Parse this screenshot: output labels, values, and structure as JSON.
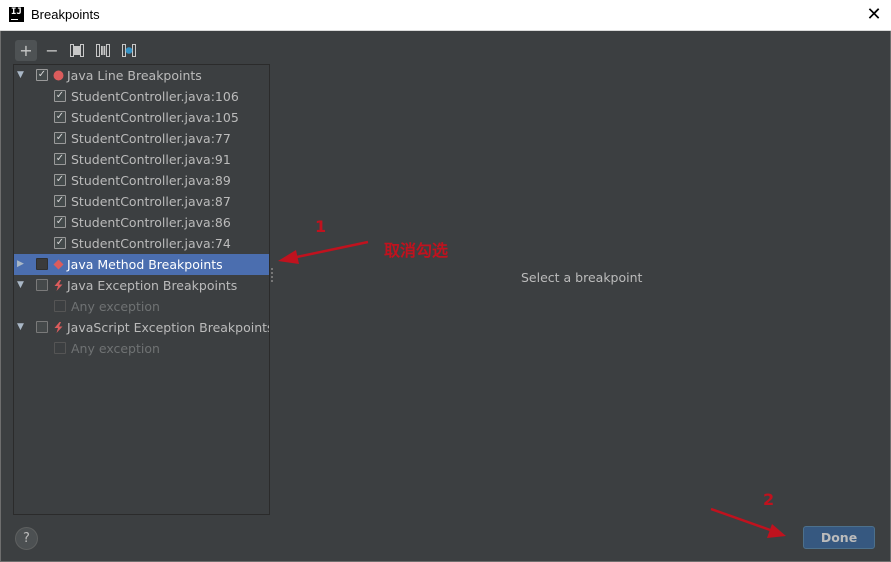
{
  "window": {
    "title": "Breakpoints",
    "app_icon_text": "IJ",
    "close_glyph": "✕"
  },
  "toolbar": {
    "add": "+",
    "remove": "−",
    "icons": [
      "add-icon",
      "remove-icon",
      "group-by-package-icon",
      "group-by-class-icon",
      "group-by-file-icon"
    ]
  },
  "tree": {
    "categories": [
      {
        "label": "Java Line Breakpoints",
        "expanded": true,
        "checked": true,
        "icon": "red-dot-icon",
        "items": [
          "StudentController.java:106",
          "StudentController.java:105",
          "StudentController.java:77",
          "StudentController.java:91",
          "StudentController.java:89",
          "StudentController.java:87",
          "StudentController.java:86",
          "StudentController.java:74"
        ]
      },
      {
        "label": "Java Method Breakpoints",
        "expanded": false,
        "checked": false,
        "selected": true,
        "icon": "red-diamond-icon"
      },
      {
        "label": "Java Exception Breakpoints",
        "expanded": true,
        "checked": false,
        "icon": "lightning-icon",
        "items": [
          "Any exception"
        ]
      },
      {
        "label": "JavaScript Exception Breakpoints",
        "expanded": true,
        "checked": false,
        "icon": "lightning-icon",
        "items": [
          "Any exception"
        ]
      }
    ]
  },
  "detail": {
    "placeholder": "Select a breakpoint"
  },
  "annotations": {
    "step1_number": "1",
    "step1_text": "取消勾选",
    "step2_number": "2"
  },
  "buttons": {
    "help": "?",
    "done": "Done"
  },
  "colors": {
    "selection": "#4b6eaf",
    "annotation": "#c0121e",
    "background": "#3c3f41"
  }
}
